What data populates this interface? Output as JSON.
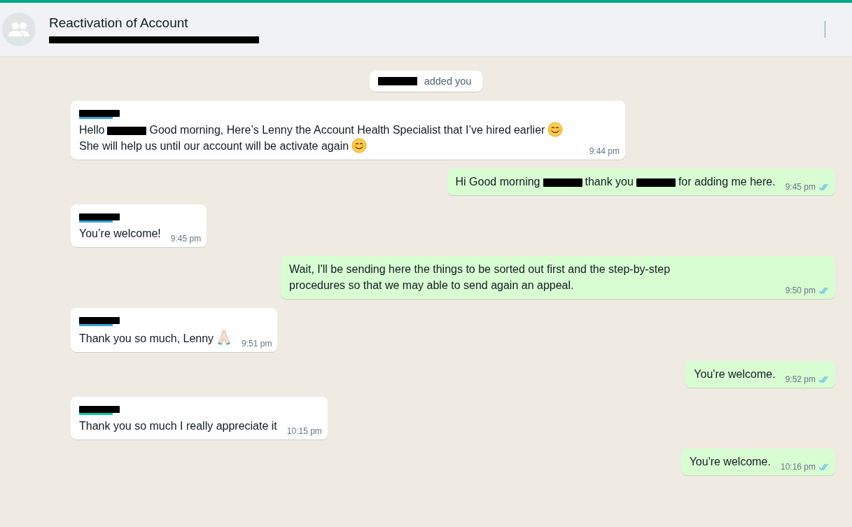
{
  "header": {
    "title": "Reactivation of Account",
    "subtitle_redacted": true
  },
  "messages": [
    {
      "kind": "system",
      "segments": [
        {
          "kind": "redacted"
        },
        {
          "kind": "text",
          "text": "added you"
        }
      ]
    },
    {
      "kind": "in",
      "color": "#35a6d8",
      "segments": [
        {
          "kind": "text",
          "text": "Hello"
        },
        {
          "kind": "redacted"
        },
        {
          "kind": "text",
          "text": "Good morning, Here’s Lenny the Account Health Specialist that I’ve hired"
        },
        {
          "kind": "text",
          "text": "earlier"
        },
        {
          "kind": "smiley"
        },
        {
          "kind": "text",
          "text": "She will help us until our account will be activate again"
        },
        {
          "kind": "smiley"
        }
      ],
      "time": "9:44 pm"
    },
    {
      "kind": "out",
      "segments": [
        {
          "kind": "text",
          "text": "Hi Good morning"
        },
        {
          "kind": "redacted"
        },
        {
          "kind": "text",
          "text": "thank you"
        },
        {
          "kind": "redacted"
        },
        {
          "kind": "text",
          "text": "for adding me here."
        }
      ],
      "time": "9:45 pm",
      "read": true
    },
    {
      "kind": "in",
      "color": "#35a6d8",
      "segments": [
        {
          "kind": "text",
          "text": "You’re welcome!"
        }
      ],
      "time": "9:45 pm"
    },
    {
      "kind": "out",
      "segments": [
        {
          "kind": "text",
          "text": "Wait, I'll be sending here the things to be sorted out first and the step-by-step"
        },
        {
          "kind": "text",
          "text": "procedures so that we may able to send again an appeal."
        }
      ],
      "time": "9:50 pm",
      "read": true
    },
    {
      "kind": "in",
      "color": "#35a6d8",
      "segments": [
        {
          "kind": "text",
          "text": "Thank you so much, Lenny"
        },
        {
          "kind": "hands"
        }
      ],
      "time": "9:51 pm"
    },
    {
      "kind": "out",
      "segments": [
        {
          "kind": "text",
          "text": "You're welcome."
        }
      ],
      "time": "9:52 pm",
      "read": true
    },
    {
      "kind": "in",
      "color": "#06cf9c",
      "segments": [
        {
          "kind": "text",
          "text": "Thank you so much I really appreciate it"
        }
      ],
      "time": "10:15 pm"
    },
    {
      "kind": "out",
      "segments": [
        {
          "kind": "text",
          "text": "You're welcome."
        }
      ],
      "time": "10:16 pm",
      "read": true
    }
  ]
}
